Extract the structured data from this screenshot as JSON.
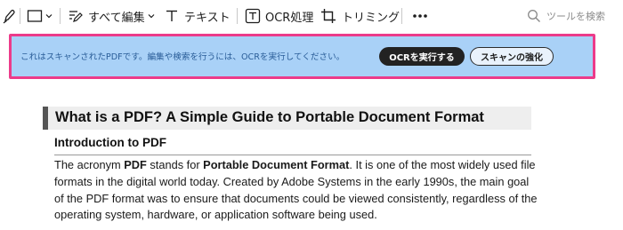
{
  "toolbar": {
    "items": [
      {
        "name": "pen-tool",
        "icon": "pen-icon"
      },
      {
        "name": "shape-tool",
        "icon": "rectangle-icon",
        "dropdown": true
      },
      {
        "name": "edit-all",
        "icon": "edit-text-icon",
        "label": "すべて編集",
        "dropdown": true
      },
      {
        "name": "text",
        "icon": "text-icon",
        "label": "テキスト"
      },
      {
        "name": "ocr",
        "icon": "ocr-icon",
        "label": "OCR処理"
      },
      {
        "name": "trimming",
        "icon": "crop-icon",
        "label": "トリミング"
      },
      {
        "name": "more",
        "icon": "more-horizontal-icon"
      }
    ],
    "search_placeholder": "ツールを検索"
  },
  "banner": {
    "message": "これはスキャンされたPDFです。編集や検索を行うには、OCRを実行してください。",
    "ocr_button": "OCRを実行する",
    "enhance_button": "スキャンの強化",
    "highlight_color": "#ec3b8a",
    "background_color": "#a9d1f7"
  },
  "document": {
    "title": "What is a PDF? A Simple Guide to Portable Document Format",
    "subtitle": "Introduction to PDF",
    "body": {
      "lines": [
        {
          "parts": [
            {
              "text": "The acronym "
            },
            {
              "text": "PDF",
              "bold": true
            },
            {
              "text": " stands for "
            },
            {
              "text": "Portable Document Format",
              "bold": true
            },
            {
              "text": ". It is one of the most widely used file"
            }
          ]
        },
        {
          "parts": [
            {
              "text": "formats in the digital world today. Created by Adobe Systems in the early 1990s, the main goal"
            }
          ]
        },
        {
          "parts": [
            {
              "text": "of the PDF format was to ensure that documents could be viewed consistently, regardless of the"
            }
          ]
        },
        {
          "parts": [
            {
              "text": "operating system, hardware, or application software being used."
            }
          ]
        }
      ]
    }
  }
}
